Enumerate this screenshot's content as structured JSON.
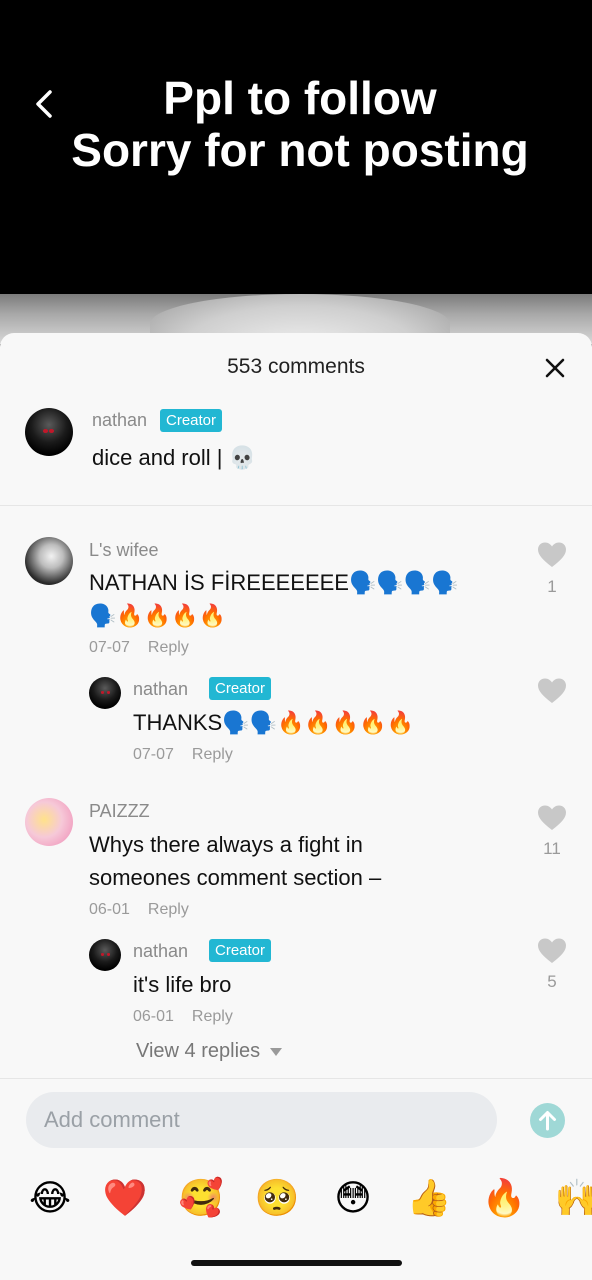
{
  "video": {
    "caption_line1": "Ppl to follow",
    "caption_line2": "Sorry for not posting"
  },
  "sheet": {
    "title": "553 comments",
    "close_icon": "close-icon"
  },
  "pinned": {
    "username": "nathan",
    "badge": "Creator",
    "text": "dice and roll | 💀"
  },
  "comments": [
    {
      "username": "L's wifee",
      "text_line1": "NATHAN İS FİREEEEEEE🗣️🗣️🗣️🗣️",
      "text_line2": "🗣️🔥🔥🔥🔥",
      "date": "07-07",
      "reply_label": "Reply",
      "likes": "1",
      "replies": [
        {
          "username": "nathan",
          "badge": "Creator",
          "text": "THANKS🗣️🗣️🔥🔥🔥🔥🔥",
          "date": "07-07",
          "reply_label": "Reply",
          "likes": ""
        }
      ]
    },
    {
      "username": "PAIZZZ",
      "text_line1": "Whys there always a fight in",
      "text_line2": "someones comment section –",
      "date": "06-01",
      "reply_label": "Reply",
      "likes": "11",
      "replies": [
        {
          "username": "nathan",
          "badge": "Creator",
          "text": "it's life bro",
          "date": "06-01",
          "reply_label": "Reply",
          "likes": "5"
        }
      ],
      "view_replies": "View 4 replies"
    }
  ],
  "input": {
    "placeholder": "Add comment"
  },
  "emoji_bar": [
    "😂",
    "❤️",
    "🥰",
    "🥺",
    "😳",
    "👍",
    "🔥",
    "🙌"
  ],
  "colors": {
    "badge": "#22b7d3",
    "send": "#9fd8d6",
    "sheet_bg": "#f8f8f8"
  }
}
